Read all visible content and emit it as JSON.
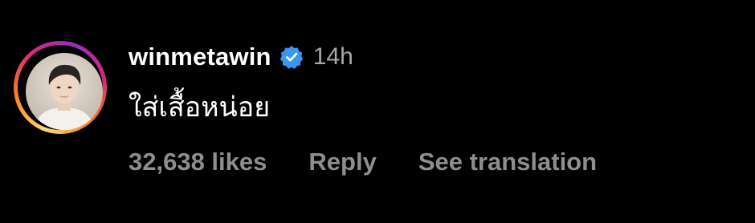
{
  "comment": {
    "username": "winmetawin",
    "verified": true,
    "verified_icon": "verified-badge-icon",
    "timestamp": "14h",
    "text": "ใส่เสื้อหน่อย",
    "actions": {
      "likes": "32,638 likes",
      "reply": "Reply",
      "translate": "See translation"
    }
  },
  "colors": {
    "background": "#000000",
    "username": "#ffffff",
    "timestamp": "#a8a8a8",
    "actions": "#8e8e8e",
    "verified": "#3897f0"
  }
}
